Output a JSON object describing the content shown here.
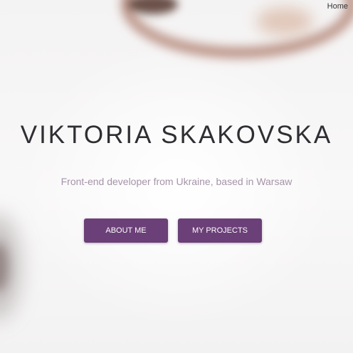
{
  "nav": {
    "home_label": "Home"
  },
  "hero": {
    "name": "VIKTORIA SKAKOVSKA",
    "tagline": "Front-end developer from Ukraine, based in Warsaw"
  },
  "buttons": {
    "about_label": "ABOUT ME",
    "projects_label": "MY PROJECTS"
  },
  "colors": {
    "accent": "#6b3f78",
    "title": "#2e2e33",
    "tagline": "#a594a9"
  }
}
